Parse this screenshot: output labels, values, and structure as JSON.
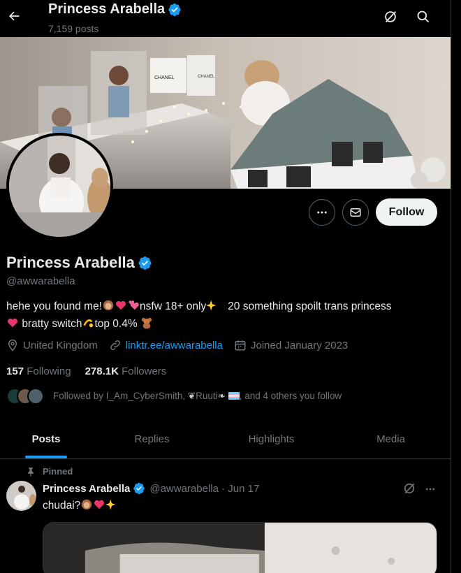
{
  "header": {
    "title": "Princess Arabella",
    "post_count": "7,159 posts"
  },
  "profile": {
    "display_name": "Princess Arabella",
    "handle": "@awwarabella",
    "bio_line1_a": "hehe you found me!",
    "bio_line1_b": "nsfw 18+ only",
    "bio_line1_c": "20 something spoilt trans princess",
    "bio_line2_a": "bratty switch",
    "bio_line2_b": "top 0.4%",
    "location": "United Kingdom",
    "link": "linktr.ee/awwarabella",
    "joined": "Joined January 2023",
    "following_count": "157",
    "following_label": "Following",
    "followers_count": "278.1K",
    "followers_label": "Followers",
    "followed_by": "Followed by I_Am_CyberSmith,",
    "followed_by_2": "Ruuti",
    "followed_by_3": ", and 4 others you follow"
  },
  "actions": {
    "follow_label": "Follow"
  },
  "tabs": [
    {
      "label": "Posts",
      "active": true
    },
    {
      "label": "Replies",
      "active": false
    },
    {
      "label": "Highlights",
      "active": false
    },
    {
      "label": "Media",
      "active": false
    }
  ],
  "pinned_post": {
    "pinned_label": "Pinned",
    "author_name": "Princess Arabella",
    "author_meta": "@awwarabella · Jun 17",
    "text": "chudai?"
  },
  "colors": {
    "accent": "#1d9bf0",
    "verified": "#1d9bf0",
    "muted": "#71767b",
    "background": "#000000"
  },
  "icons": [
    "back-arrow-icon",
    "grok-icon",
    "search-icon",
    "more-icon",
    "message-icon",
    "verified-badge-icon",
    "location-icon",
    "link-icon",
    "calendar-icon",
    "pin-icon"
  ]
}
